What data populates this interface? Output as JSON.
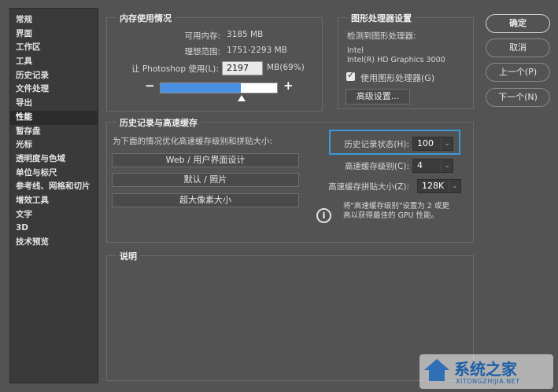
{
  "sidebar": {
    "items": [
      "常规",
      "界面",
      "工作区",
      "工具",
      "历史记录",
      "文件处理",
      "导出",
      "性能",
      "暂存盘",
      "光标",
      "透明度与色域",
      "单位与标尺",
      "参考线、网格和切片",
      "增效工具",
      "文字",
      "3D",
      "技术预览"
    ],
    "active_index": 7
  },
  "memory": {
    "title": "内存使用情况",
    "available_label": "可用内存:",
    "available_value": "3185 MB",
    "ideal_label": "理想范围:",
    "ideal_value": "1751-2293 MB",
    "let_label": "让 Photoshop 使用(L):",
    "let_value": "2197",
    "unit_percent": "MB(69%)",
    "minus": "−",
    "plus": "+",
    "slider_fraction": 0.69
  },
  "gpu": {
    "title": "图形处理器设置",
    "detected_label": "检测到图形处理器:",
    "vendor": "Intel",
    "model": "Intel(R) HD Graphics 3000",
    "use_gpu_label": "使用图形处理器(G)",
    "use_gpu_checked": true,
    "advanced_button": "高级设置..."
  },
  "history_cache": {
    "title": "历史记录与高速缓存",
    "optimize_label": "为下面的情况优化高速缓存级别和拼贴大小:",
    "preset_buttons": [
      "Web / 用户界面设计",
      "默认 / 照片",
      "超大像素大小"
    ],
    "history_states_label": "历史记录状态(H):",
    "history_states_value": "100",
    "cache_levels_label": "高速缓存级别(C):",
    "cache_levels_value": "4",
    "tile_size_label": "高速缓存拼贴大小(Z):",
    "tile_size_value": "128K",
    "info_icon": "i",
    "info_line1": "将\"高速缓存级别\"设置为 2 或更",
    "info_line2": "高以获得最佳的 GPU 性能。"
  },
  "description": {
    "title": "说明"
  },
  "actions": {
    "ok": "确定",
    "cancel": "取消",
    "prev": "上一个(P)",
    "next": "下一个(N)"
  },
  "watermark": {
    "name": "系统之家",
    "url": "XITONGZHIJIA.NET"
  },
  "colors": {
    "background": "#535353",
    "slider_fill": "#4a90e2",
    "highlight_border": "#3a9bd9"
  }
}
